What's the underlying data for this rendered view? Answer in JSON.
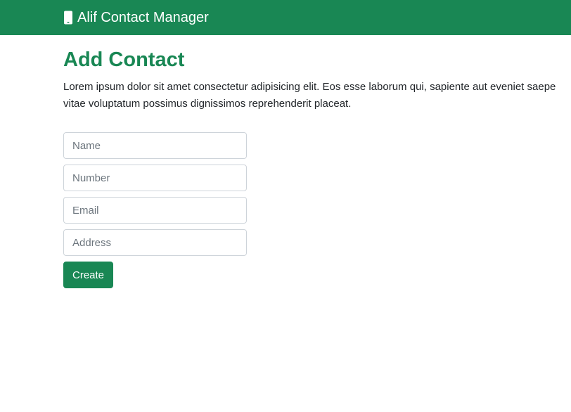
{
  "navbar": {
    "brand_icon": "mobile-phone-icon",
    "brand_text": "Alif Contact Manager",
    "color": "#198754"
  },
  "page": {
    "title": "Add Contact",
    "description_line1": "Lorem ipsum dolor sit amet consectetur adipisicing elit. Eos esse laborum qui, sapiente aut eveniet saepe",
    "description_line2": "vitae voluptatum possimus dignissimos reprehenderit placeat."
  },
  "form": {
    "name_placeholder": "Name",
    "number_placeholder": "Number",
    "email_placeholder": "Email",
    "address_placeholder": "Address",
    "name_value": "",
    "number_value": "",
    "email_value": "",
    "address_value": "",
    "submit_label": "Create"
  }
}
